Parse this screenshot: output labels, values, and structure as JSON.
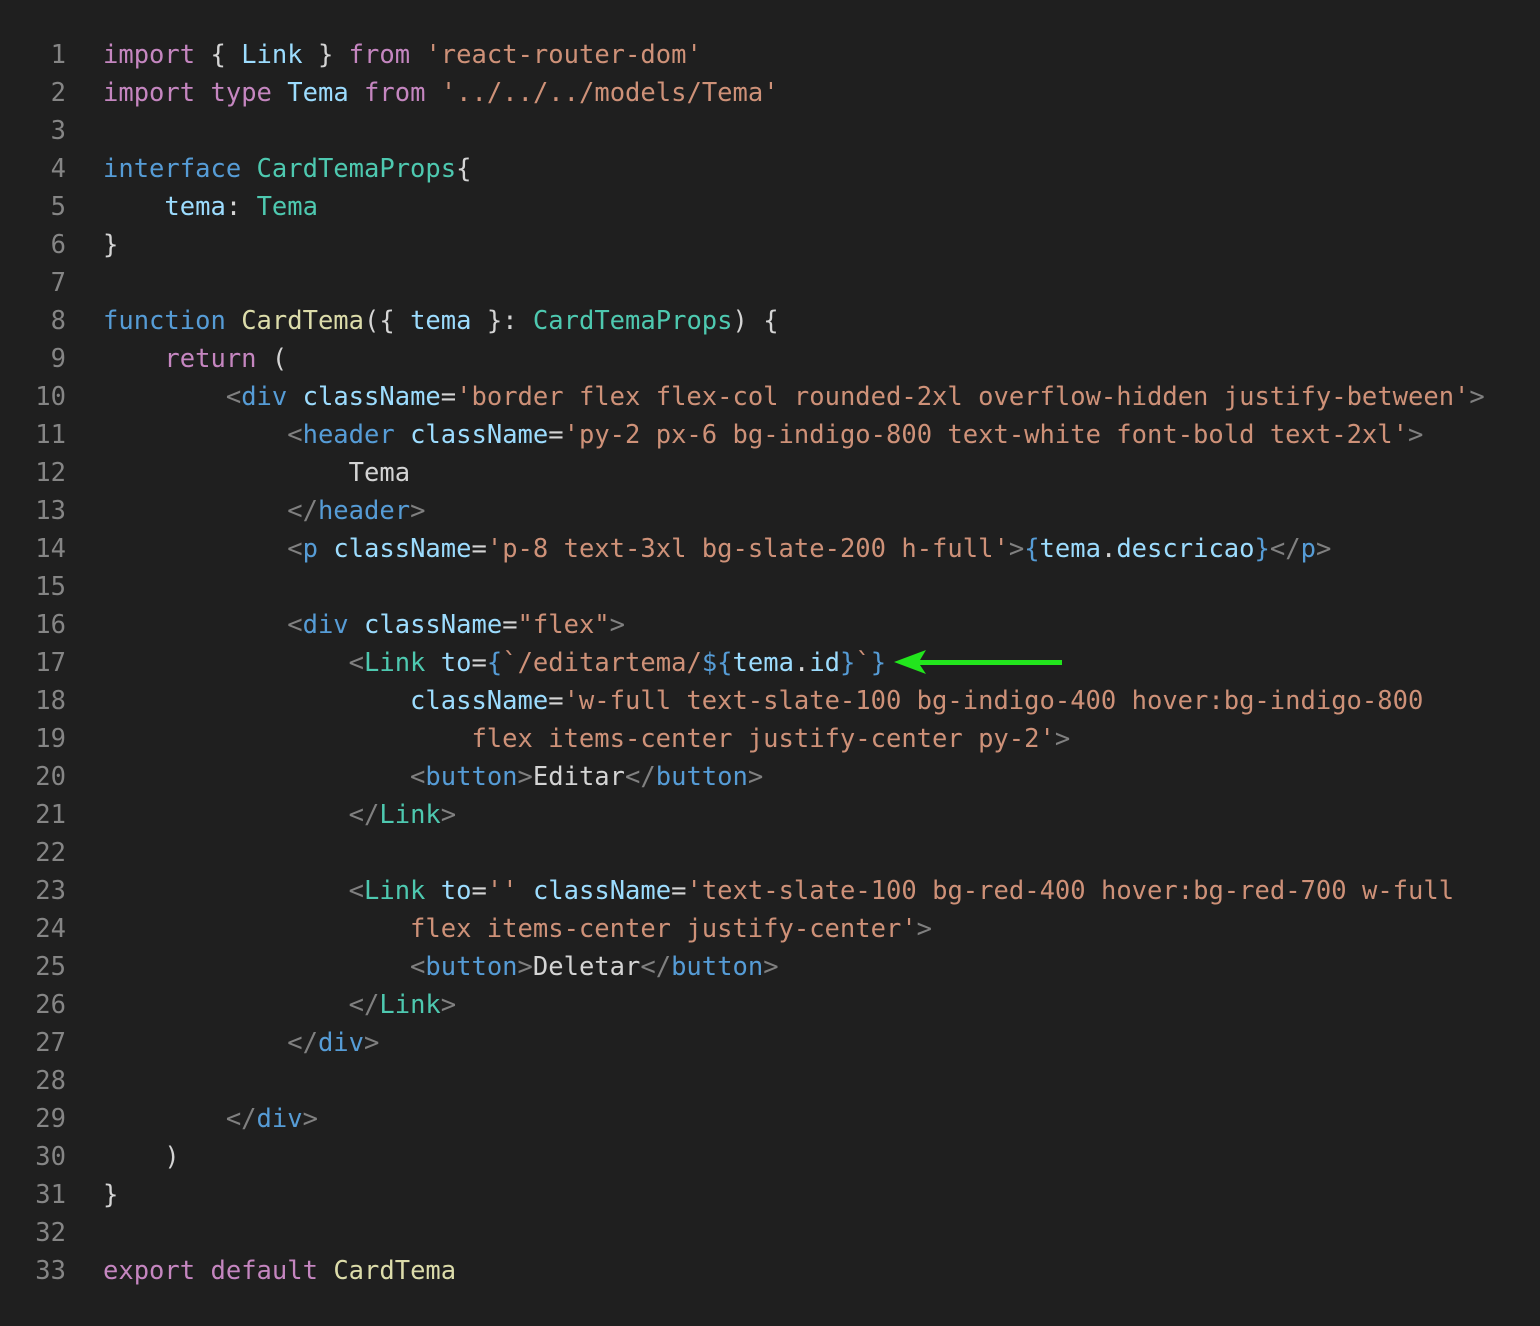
{
  "editor": {
    "language": "typescriptreact",
    "theme": {
      "background": "#1f1f1f",
      "line_number": "#858585",
      "keyword_control": "#c586c0",
      "keyword_storage": "#569cd6",
      "variable": "#9cdcfe",
      "type": "#4ec9b0",
      "function": "#dcdcaa",
      "string": "#ce9178",
      "punctuation": "#808080",
      "annotation_arrow": "#22e51d"
    },
    "annotation": {
      "icon": "arrow-left-icon",
      "points_to_line": 17
    },
    "lines": [
      {
        "n": "1",
        "t": [
          [
            "kw",
            "import"
          ],
          [
            "br",
            " { "
          ],
          [
            "var",
            "Link"
          ],
          [
            "br",
            " } "
          ],
          [
            "kw",
            "from"
          ],
          [
            "br",
            " "
          ],
          [
            "str",
            "'react-router-dom'"
          ]
        ]
      },
      {
        "n": "2",
        "t": [
          [
            "kw",
            "import"
          ],
          [
            "br",
            " "
          ],
          [
            "kw",
            "type"
          ],
          [
            "br",
            " "
          ],
          [
            "var",
            "Tema"
          ],
          [
            "br",
            " "
          ],
          [
            "kw",
            "from"
          ],
          [
            "br",
            " "
          ],
          [
            "str",
            "'../../../models/Tema'"
          ]
        ]
      },
      {
        "n": "3",
        "t": []
      },
      {
        "n": "4",
        "t": [
          [
            "st",
            "interface"
          ],
          [
            "br",
            " "
          ],
          [
            "type",
            "CardTemaProps"
          ],
          [
            "br",
            "{"
          ]
        ]
      },
      {
        "n": "5",
        "t": [
          [
            "br",
            "    "
          ],
          [
            "var",
            "tema"
          ],
          [
            "br",
            ": "
          ],
          [
            "type",
            "Tema"
          ]
        ]
      },
      {
        "n": "6",
        "t": [
          [
            "br",
            "}"
          ]
        ]
      },
      {
        "n": "7",
        "t": []
      },
      {
        "n": "8",
        "t": [
          [
            "st",
            "function"
          ],
          [
            "br",
            " "
          ],
          [
            "fn",
            "CardTema"
          ],
          [
            "br",
            "({ "
          ],
          [
            "var",
            "tema"
          ],
          [
            "br",
            " }: "
          ],
          [
            "type",
            "CardTemaProps"
          ],
          [
            "br",
            ") {"
          ]
        ]
      },
      {
        "n": "9",
        "t": [
          [
            "br",
            "    "
          ],
          [
            "kw",
            "return"
          ],
          [
            "br",
            " ("
          ]
        ]
      },
      {
        "n": "10",
        "t": [
          [
            "br",
            "        "
          ],
          [
            "tag",
            "<"
          ],
          [
            "tn",
            "div"
          ],
          [
            "br",
            " "
          ],
          [
            "at",
            "className"
          ],
          [
            "br",
            "="
          ],
          [
            "str",
            "'border flex flex-col rounded-2xl overflow-hidden justify-between'"
          ],
          [
            "tag",
            ">"
          ]
        ]
      },
      {
        "n": "11",
        "t": [
          [
            "br",
            "            "
          ],
          [
            "tag",
            "<"
          ],
          [
            "tn",
            "header"
          ],
          [
            "br",
            " "
          ],
          [
            "at",
            "className"
          ],
          [
            "br",
            "="
          ],
          [
            "str",
            "'py-2 px-6 bg-indigo-800 text-white font-bold text-2xl'"
          ],
          [
            "tag",
            ">"
          ]
        ]
      },
      {
        "n": "12",
        "t": [
          [
            "txt",
            "                Tema"
          ]
        ]
      },
      {
        "n": "13",
        "t": [
          [
            "br",
            "            "
          ],
          [
            "tag",
            "</"
          ],
          [
            "tn",
            "header"
          ],
          [
            "tag",
            ">"
          ]
        ]
      },
      {
        "n": "14",
        "t": [
          [
            "br",
            "            "
          ],
          [
            "tag",
            "<"
          ],
          [
            "tn",
            "p"
          ],
          [
            "br",
            " "
          ],
          [
            "at",
            "className"
          ],
          [
            "br",
            "="
          ],
          [
            "str",
            "'p-8 text-3xl bg-slate-200 h-full'"
          ],
          [
            "tag",
            ">"
          ],
          [
            "st",
            "{"
          ],
          [
            "var",
            "tema"
          ],
          [
            "br",
            "."
          ],
          [
            "var",
            "descricao"
          ],
          [
            "st",
            "}"
          ],
          [
            "tag",
            "</"
          ],
          [
            "tn",
            "p"
          ],
          [
            "tag",
            ">"
          ]
        ]
      },
      {
        "n": "15",
        "t": []
      },
      {
        "n": "16",
        "t": [
          [
            "br",
            "            "
          ],
          [
            "tag",
            "<"
          ],
          [
            "tn",
            "div"
          ],
          [
            "br",
            " "
          ],
          [
            "at",
            "className"
          ],
          [
            "br",
            "="
          ],
          [
            "str",
            "\"flex\""
          ],
          [
            "tag",
            ">"
          ]
        ]
      },
      {
        "n": "17",
        "t": [
          [
            "br",
            "                "
          ],
          [
            "tag",
            "<"
          ],
          [
            "cmp",
            "Link"
          ],
          [
            "br",
            " "
          ],
          [
            "at",
            "to"
          ],
          [
            "br",
            "="
          ],
          [
            "st",
            "{"
          ],
          [
            "str",
            "`/editartema/"
          ],
          [
            "st",
            "${"
          ],
          [
            "var",
            "tema"
          ],
          [
            "br",
            "."
          ],
          [
            "var",
            "id"
          ],
          [
            "st",
            "}"
          ],
          [
            "str",
            "`"
          ],
          [
            "st",
            "}"
          ]
        ]
      },
      {
        "n": "18",
        "t": [
          [
            "br",
            "                    "
          ],
          [
            "at",
            "className"
          ],
          [
            "br",
            "="
          ],
          [
            "str",
            "'w-full text-slate-100 bg-indigo-400 hover:bg-indigo-800"
          ]
        ]
      },
      {
        "n": "19",
        "t": [
          [
            "str",
            "                        flex items-center justify-center py-2'"
          ],
          [
            "tag",
            ">"
          ]
        ]
      },
      {
        "n": "20",
        "t": [
          [
            "br",
            "                    "
          ],
          [
            "tag",
            "<"
          ],
          [
            "tn",
            "button"
          ],
          [
            "tag",
            ">"
          ],
          [
            "txt",
            "Editar"
          ],
          [
            "tag",
            "</"
          ],
          [
            "tn",
            "button"
          ],
          [
            "tag",
            ">"
          ]
        ]
      },
      {
        "n": "21",
        "t": [
          [
            "br",
            "                "
          ],
          [
            "tag",
            "</"
          ],
          [
            "cmp",
            "Link"
          ],
          [
            "tag",
            ">"
          ]
        ]
      },
      {
        "n": "22",
        "t": []
      },
      {
        "n": "23",
        "t": [
          [
            "br",
            "                "
          ],
          [
            "tag",
            "<"
          ],
          [
            "cmp",
            "Link"
          ],
          [
            "br",
            " "
          ],
          [
            "at",
            "to"
          ],
          [
            "br",
            "="
          ],
          [
            "str",
            "''"
          ],
          [
            "br",
            " "
          ],
          [
            "at",
            "className"
          ],
          [
            "br",
            "="
          ],
          [
            "str",
            "'text-slate-100 bg-red-400 hover:bg-red-700 w-full"
          ]
        ]
      },
      {
        "n": "24",
        "t": [
          [
            "str",
            "                    flex items-center justify-center'"
          ],
          [
            "tag",
            ">"
          ]
        ]
      },
      {
        "n": "25",
        "t": [
          [
            "br",
            "                    "
          ],
          [
            "tag",
            "<"
          ],
          [
            "tn",
            "button"
          ],
          [
            "tag",
            ">"
          ],
          [
            "txt",
            "Deletar"
          ],
          [
            "tag",
            "</"
          ],
          [
            "tn",
            "button"
          ],
          [
            "tag",
            ">"
          ]
        ]
      },
      {
        "n": "26",
        "t": [
          [
            "br",
            "                "
          ],
          [
            "tag",
            "</"
          ],
          [
            "cmp",
            "Link"
          ],
          [
            "tag",
            ">"
          ]
        ]
      },
      {
        "n": "27",
        "t": [
          [
            "br",
            "            "
          ],
          [
            "tag",
            "</"
          ],
          [
            "tn",
            "div"
          ],
          [
            "tag",
            ">"
          ]
        ]
      },
      {
        "n": "28",
        "t": []
      },
      {
        "n": "29",
        "t": [
          [
            "br",
            "        "
          ],
          [
            "tag",
            "</"
          ],
          [
            "tn",
            "div"
          ],
          [
            "tag",
            ">"
          ]
        ]
      },
      {
        "n": "30",
        "t": [
          [
            "br",
            "    )"
          ]
        ]
      },
      {
        "n": "31",
        "t": [
          [
            "br",
            "}"
          ]
        ]
      },
      {
        "n": "32",
        "t": []
      },
      {
        "n": "33",
        "t": [
          [
            "kw",
            "export"
          ],
          [
            "br",
            " "
          ],
          [
            "kw",
            "default"
          ],
          [
            "br",
            " "
          ],
          [
            "fn",
            "CardTema"
          ]
        ]
      }
    ]
  }
}
